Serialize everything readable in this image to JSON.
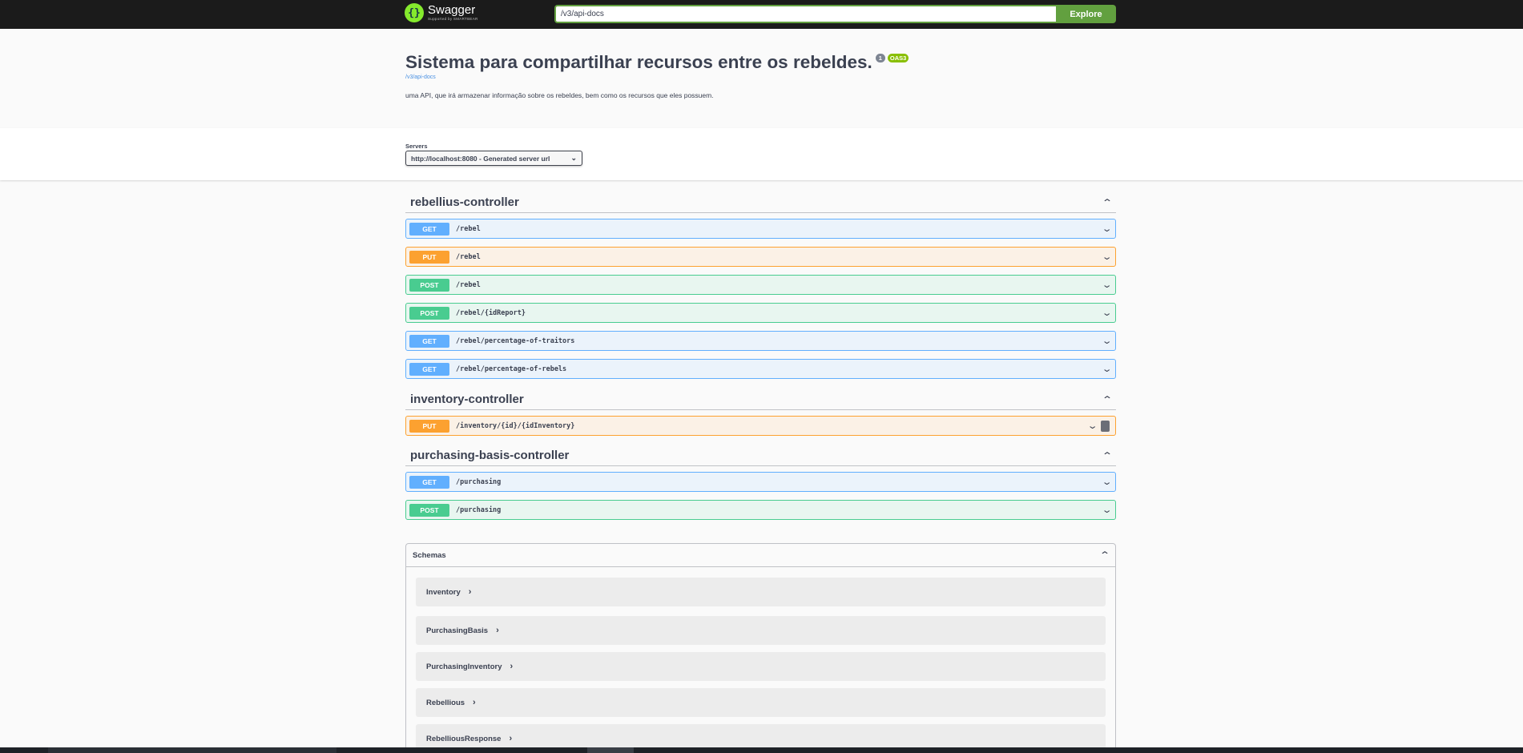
{
  "topbar": {
    "logo_name": "Swagger",
    "logo_sub": "Supported by SMARTBEAR",
    "url_value": "/v3/api-docs",
    "explore_label": "Explore"
  },
  "info": {
    "title": "Sistema para compartilhar recursos entre os rebeldes.",
    "version_badge": "1",
    "oas_badge": "OAS3",
    "spec_link": "/v3/api-docs",
    "description": "uma API, que irá armazenar informação sobre os rebeldes, bem como os recursos que eles possuem."
  },
  "servers": {
    "label": "Servers",
    "selected": "http://localhost:8080 - Generated server url"
  },
  "tags": [
    {
      "name": "rebellius-controller",
      "operations": [
        {
          "method": "GET",
          "path": "/rebel"
        },
        {
          "method": "PUT",
          "path": "/rebel"
        },
        {
          "method": "POST",
          "path": "/rebel"
        },
        {
          "method": "POST",
          "path": "/rebel/{idReport}"
        },
        {
          "method": "GET",
          "path": "/rebel/percentage-of-traitors"
        },
        {
          "method": "GET",
          "path": "/rebel/percentage-of-rebels"
        }
      ]
    },
    {
      "name": "inventory-controller",
      "operations": [
        {
          "method": "PUT",
          "path": "/inventory/{id}/{idInventory}"
        }
      ]
    },
    {
      "name": "purchasing-basis-controller",
      "operations": [
        {
          "method": "GET",
          "path": "/purchasing"
        },
        {
          "method": "POST",
          "path": "/purchasing"
        }
      ]
    }
  ],
  "schemas": {
    "label": "Schemas",
    "models": [
      "Inventory",
      "PurchasingBasis",
      "PurchasingInventory",
      "Rebellious",
      "RebelliousResponse"
    ]
  },
  "icons": {
    "collapse": "chevron-up-icon",
    "expand": "chevron-down-icon",
    "model_expand": "chevron-right-icon",
    "lock": "lock-icon"
  },
  "colors": {
    "get": "#61affe",
    "put": "#fca130",
    "post": "#49cc90",
    "explore": "#62a03f",
    "logo": "#85ea2d"
  }
}
